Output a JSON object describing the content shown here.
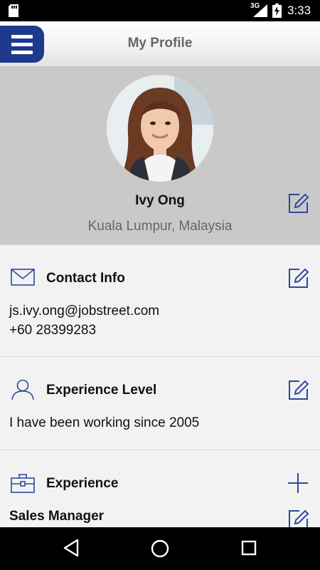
{
  "status_bar": {
    "network": "3G",
    "time": "3:33"
  },
  "header": {
    "title": "My Profile"
  },
  "profile": {
    "name": "Ivy Ong",
    "location": "Kuala Lumpur, Malaysia"
  },
  "contact": {
    "title": "Contact Info",
    "email": "js.ivy.ong@jobstreet.com",
    "phone": "+60 28399283"
  },
  "experience_level": {
    "title": "Experience Level",
    "text": "I have been working since 2005"
  },
  "experience": {
    "title": "Experience",
    "item_title": "Sales Manager"
  },
  "colors": {
    "accent": "#1e3a8c",
    "icon": "#2b4a9a",
    "header_bg": "#c9c9c9"
  },
  "icons": {
    "menu": "hamburger-icon",
    "edit": "edit-icon",
    "contact": "envelope-icon",
    "experience_level": "person-icon",
    "experience": "briefcase-icon",
    "add": "plus-icon"
  }
}
